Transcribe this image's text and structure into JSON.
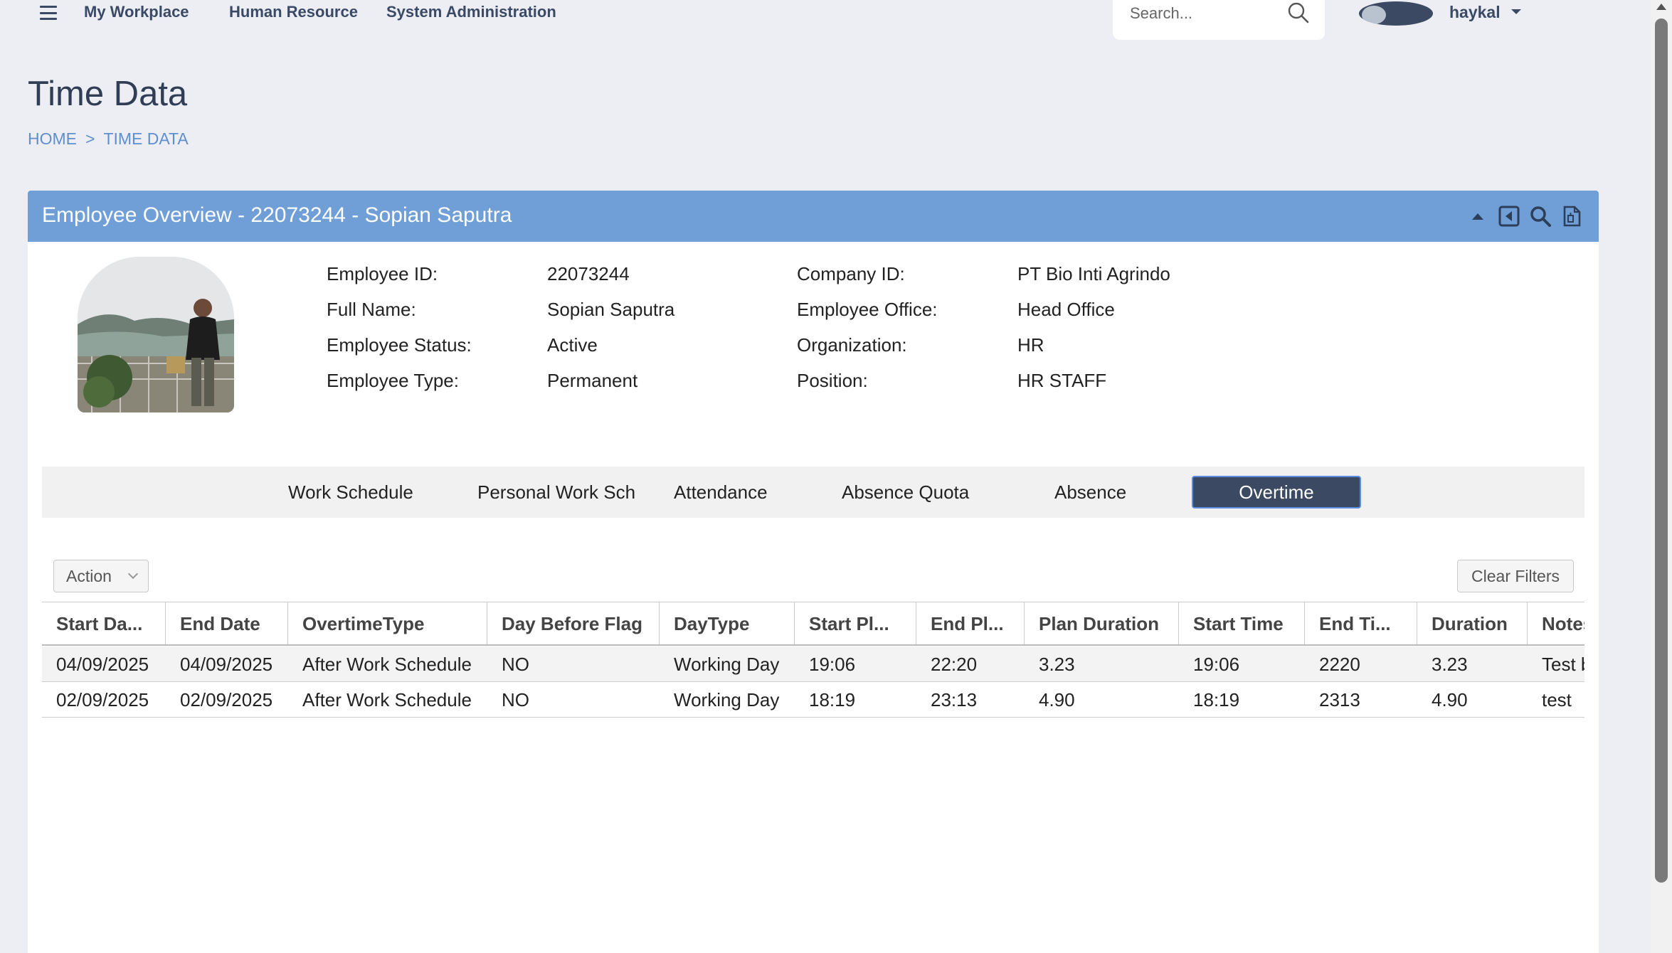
{
  "nav": {
    "menu_icon": "hamburger-icon",
    "links": [
      "My Workplace",
      "Human Resource",
      "System Administration"
    ],
    "search_placeholder": "Search...",
    "search_icon": "search-icon",
    "username": "haykal"
  },
  "page": {
    "title": "Time Data",
    "breadcrumb": [
      "HOME",
      ">",
      "TIME DATA"
    ]
  },
  "panel": {
    "title": "Employee Overview - 22073244 - Sopian Saputra",
    "header_icons": [
      "collapse-up-icon",
      "back-icon",
      "search-icon",
      "export-document-icon"
    ],
    "header_color": "#6f9fd6",
    "employee_left": [
      {
        "label": "Employee ID:",
        "value": "22073244"
      },
      {
        "label": "Full Name:",
        "value": "Sopian Saputra"
      },
      {
        "label": "Employee Status:",
        "value": "Active"
      },
      {
        "label": "Employee Type:",
        "value": "Permanent"
      }
    ],
    "employee_right": [
      {
        "label": "Company ID:",
        "value": "PT Bio Inti Agrindo"
      },
      {
        "label": "Employee Office:",
        "value": "Head Office"
      },
      {
        "label": "Organization:",
        "value": "HR"
      },
      {
        "label": "Position:",
        "value": "HR STAFF"
      }
    ],
    "tabs": [
      "Work Schedule",
      "Personal Work Sch",
      "Attendance",
      "Absence Quota",
      "Absence",
      "Overtime"
    ],
    "active_tab": "Overtime",
    "action_label": "Action",
    "clear_filters_label": "Clear Filters"
  },
  "table": {
    "columns": [
      "Start Da...",
      "End Date",
      "OvertimeType",
      "Day Before Flag",
      "DayType",
      "Start Pl...",
      "End Pl...",
      "Plan Duration",
      "Start Time",
      "End Ti...",
      "Duration",
      "Notes"
    ],
    "rows": [
      [
        "04/09/2025",
        "04/09/2025",
        "After Work Schedule",
        "NO",
        "Working Day",
        "19:06",
        "22:20",
        "3.23",
        "19:06",
        "2220",
        "3.23",
        "Test b"
      ],
      [
        "02/09/2025",
        "02/09/2025",
        "After Work Schedule",
        "NO",
        "Working Day",
        "18:19",
        "23:13",
        "4.90",
        "18:19",
        "2313",
        "4.90",
        "test"
      ]
    ]
  },
  "colors": {
    "active_tab_bg": "#3b4a62",
    "link": "#5f8fd0"
  }
}
